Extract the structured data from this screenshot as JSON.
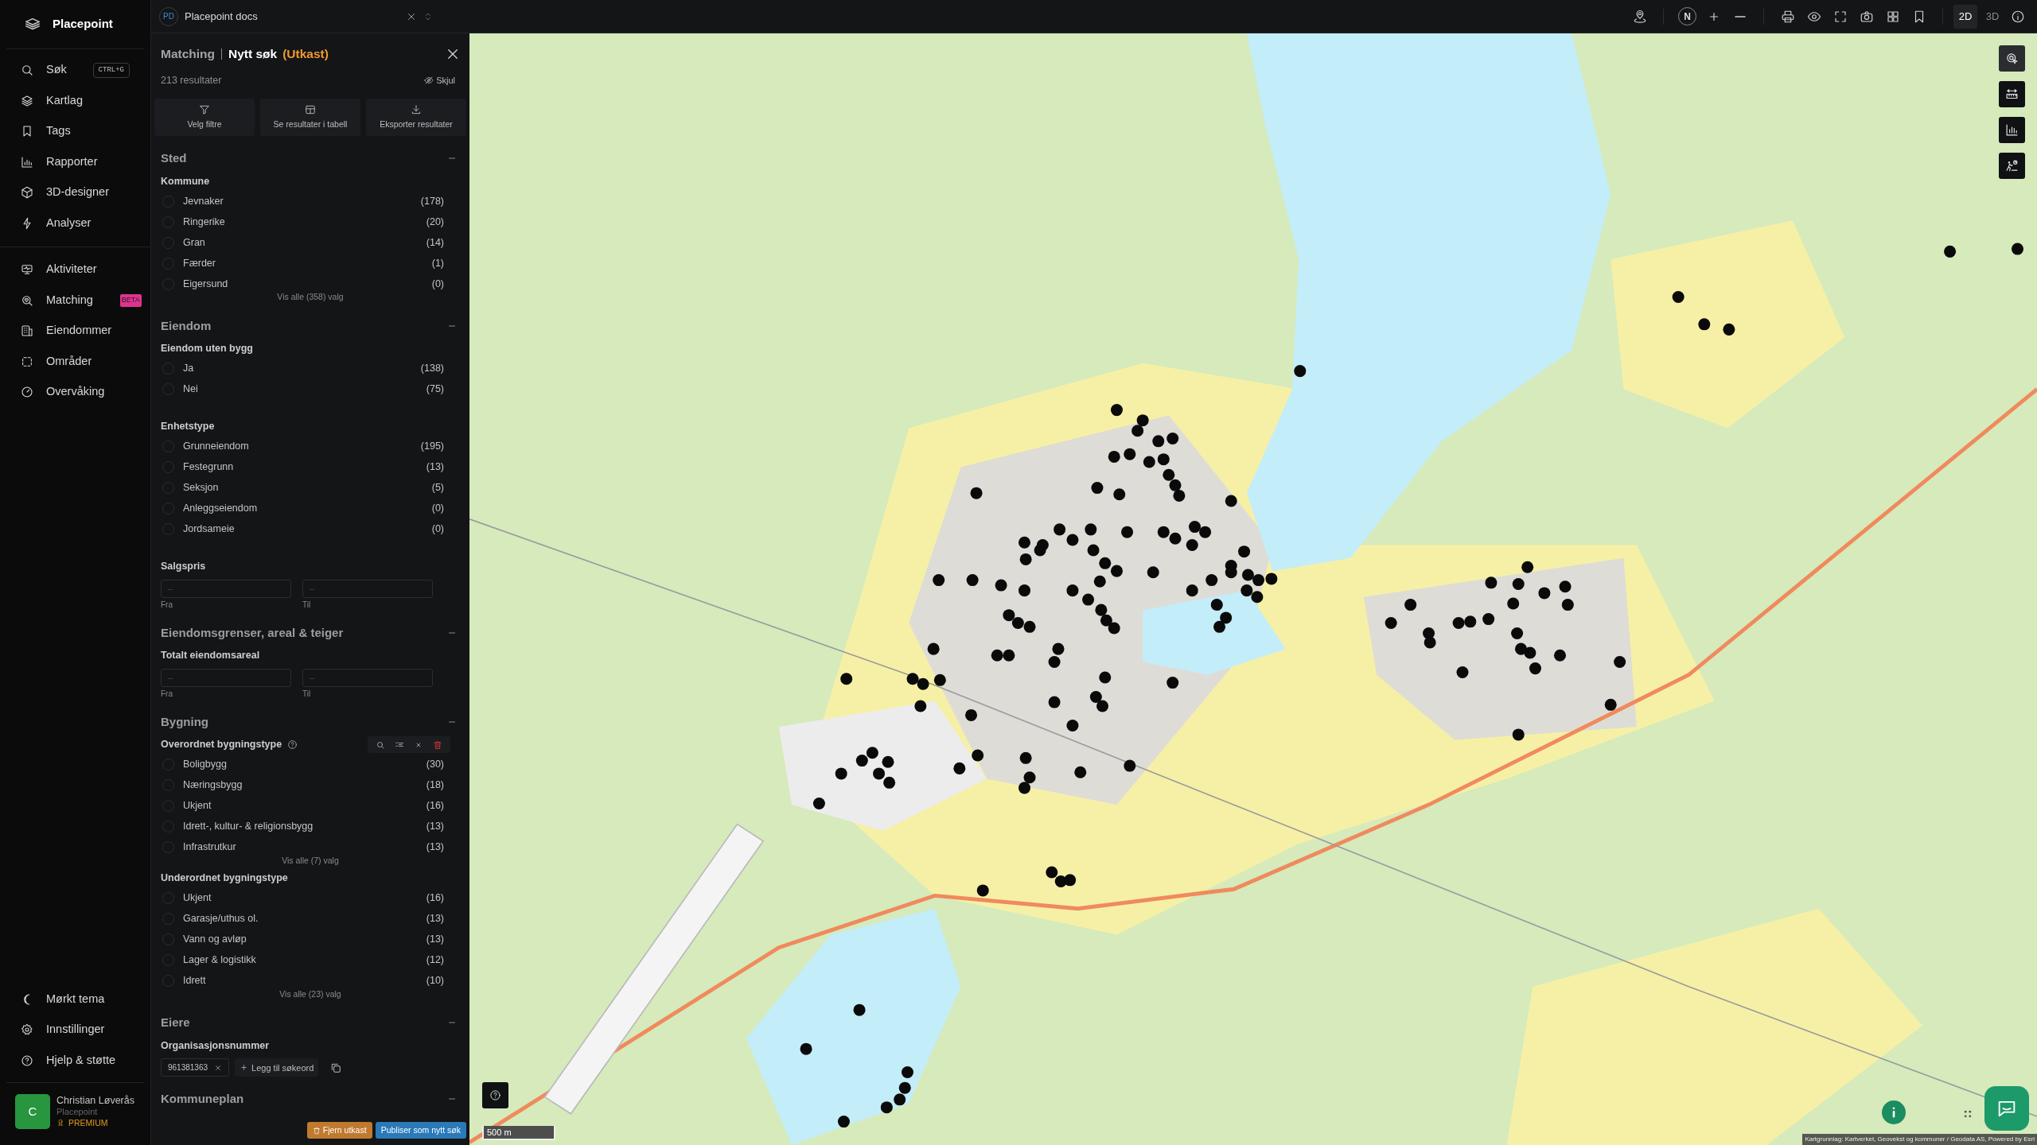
{
  "sidebar": {
    "brand": "Placepoint",
    "nav": [
      {
        "label": "Søk",
        "shortcut": "CTRL+G",
        "selected": false
      },
      {
        "label": "Kartlag",
        "selected": false
      },
      {
        "label": "Tags",
        "selected": false
      },
      {
        "label": "Rapporter",
        "selected": false
      },
      {
        "label": "3D-designer",
        "selected": false
      },
      {
        "label": "Analyser",
        "selected": false
      }
    ],
    "nav_secondary": [
      {
        "label": "Aktiviteter",
        "selected": false
      },
      {
        "label": "Matching",
        "badge": "BETA",
        "selected": false
      },
      {
        "label": "Eiendommer",
        "selected": false
      },
      {
        "label": "Områder",
        "selected": false
      },
      {
        "label": "Overvåking",
        "selected": false
      }
    ],
    "nav_bottom": [
      {
        "label": "Mørkt tema"
      },
      {
        "label": "Innstillinger"
      },
      {
        "label": "Hjelp & støtte"
      }
    ],
    "user": {
      "initial": "C",
      "name": "Christian Løverås",
      "org": "Placepoint",
      "plan": "PREMIUM"
    }
  },
  "doc_tab": {
    "initials": "PD",
    "title": "Placepoint docs"
  },
  "panel": {
    "crumb": "Matching",
    "title": "Nytt søk",
    "status": "(Utkast)",
    "results": "213 resultater",
    "hide": "Skjul",
    "actions": [
      {
        "kind": "filter",
        "label": "Velg filtre"
      },
      {
        "kind": "table",
        "label": "Se resultater i tabell"
      },
      {
        "kind": "export",
        "label": "Eksporter resultater"
      }
    ],
    "sections": [
      {
        "title": "Sted",
        "expanded": true,
        "groups": [
          {
            "kind": "options",
            "title": "Kommune",
            "items": [
              {
                "label": "Jevnaker",
                "count": "(178)",
                "checked": false
              },
              {
                "label": "Ringerike",
                "count": "(20)",
                "checked": false
              },
              {
                "label": "Gran",
                "count": "(14)",
                "checked": false
              },
              {
                "label": "Færder",
                "count": "(1)",
                "checked": false
              },
              {
                "label": "Eigersund",
                "count": "(0)",
                "checked": false
              }
            ],
            "more": "Vis alle (358) valg"
          }
        ]
      },
      {
        "title": "Eiendom",
        "expanded": true,
        "groups": [
          {
            "kind": "options",
            "title": "Eiendom uten bygg",
            "items": [
              {
                "label": "Ja",
                "count": "(138)",
                "checked": false
              },
              {
                "label": "Nei",
                "count": "(75)",
                "checked": false
              }
            ]
          },
          {
            "kind": "options",
            "title": "Enhetstype",
            "items": [
              {
                "label": "Grunneiendom",
                "count": "(195)",
                "checked": false
              },
              {
                "label": "Festegrunn",
                "count": "(13)",
                "checked": false
              },
              {
                "label": "Seksjon",
                "count": "(5)",
                "checked": false
              },
              {
                "label": "Anleggseiendom",
                "count": "(0)",
                "checked": false
              },
              {
                "label": "Jordsameie",
                "count": "(0)",
                "checked": false
              }
            ]
          },
          {
            "kind": "range",
            "title": "Salgspris",
            "from_placeholder": "–",
            "to_placeholder": "–",
            "from": "Fra",
            "to": "Til"
          }
        ]
      },
      {
        "title": "Eiendomsgrenser, areal & teiger",
        "expanded": true,
        "groups": [
          {
            "kind": "range",
            "title": "Totalt eiendomsareal",
            "from_placeholder": "–",
            "to_placeholder": "–",
            "from": "Fra",
            "to": "Til"
          }
        ]
      },
      {
        "title": "Bygning",
        "expanded": true,
        "groups": [
          {
            "kind": "options",
            "title": "Overordnet bygningstype",
            "help": true,
            "tools": true,
            "items": [
              {
                "label": "Boligbygg",
                "count": "(30)",
                "checked": false
              },
              {
                "label": "Næringsbygg",
                "count": "(18)",
                "checked": false
              },
              {
                "label": "Ukjent",
                "count": "(16)",
                "checked": false
              },
              {
                "label": "Idrett-, kultur- & religionsbygg",
                "count": "(13)",
                "checked": false
              },
              {
                "label": "Infrastrutkur",
                "count": "(13)",
                "checked": false
              }
            ],
            "more": "Vis alle (7) valg"
          },
          {
            "kind": "options",
            "title": "Underordnet bygningstype",
            "items": [
              {
                "label": "Ukjent",
                "count": "(16)",
                "checked": false
              },
              {
                "label": "Garasje/uthus ol.",
                "count": "(13)",
                "checked": false
              },
              {
                "label": "Vann og avløp",
                "count": "(13)",
                "checked": false
              },
              {
                "label": "Lager & logistikk",
                "count": "(12)",
                "checked": false
              },
              {
                "label": "Idrett",
                "count": "(10)",
                "checked": false
              }
            ],
            "more": "Vis alle (23) valg"
          }
        ]
      },
      {
        "title": "Eiere",
        "expanded": true,
        "groups": [
          {
            "kind": "tags",
            "title": "Organisasjonsnummer",
            "tags": [
              "961381363"
            ],
            "add": "Legg til søkeord"
          }
        ]
      },
      {
        "title": "Kommuneplan",
        "expanded": true
      }
    ],
    "footer": {
      "remove": "Fjern utkast",
      "publish": "Publiser som nytt søk"
    }
  },
  "map_toolbar": {
    "compass": "N",
    "modes": [
      {
        "label": "2D",
        "selected": true
      },
      {
        "label": "3D",
        "selected": false
      }
    ]
  },
  "map_tools": [
    {
      "kind": "select",
      "selected": true
    },
    {
      "kind": "measure",
      "selected": false
    },
    {
      "kind": "chart",
      "selected": false
    },
    {
      "kind": "walk",
      "selected": false
    }
  ],
  "map": {
    "scale": "500 m",
    "attribution": "Kartgrunnlag: Kartverket, Geovekst og kommuner / Geodata AS, Powered by Esri"
  }
}
